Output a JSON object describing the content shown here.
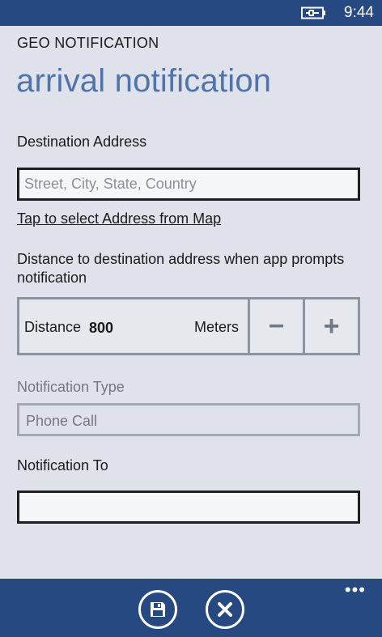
{
  "status_bar": {
    "time": "9:44",
    "battery_icon": "battery-charging-icon"
  },
  "app_label": "GEO NOTIFICATION",
  "page_title": "arrival notification",
  "destination": {
    "label": "Destination Address",
    "value": "",
    "placeholder": "Street, City, State, Country",
    "map_link": "Tap to select Address from Map"
  },
  "distance": {
    "description": "Distance to destination address when app prompts notification",
    "label": "Distance",
    "value": "800",
    "unit": "Meters",
    "decrement_label": "−",
    "increment_label": "+"
  },
  "notification_type": {
    "label": "Notification Type",
    "value": "Phone Call"
  },
  "notification_to": {
    "label": "Notification To",
    "value": ""
  },
  "app_bar": {
    "save_icon": "save-icon",
    "cancel_icon": "close-icon",
    "more_label": "•••"
  },
  "colors": {
    "accent": "#254980",
    "title": "#4f74ad",
    "background": "#dfe2ea"
  }
}
